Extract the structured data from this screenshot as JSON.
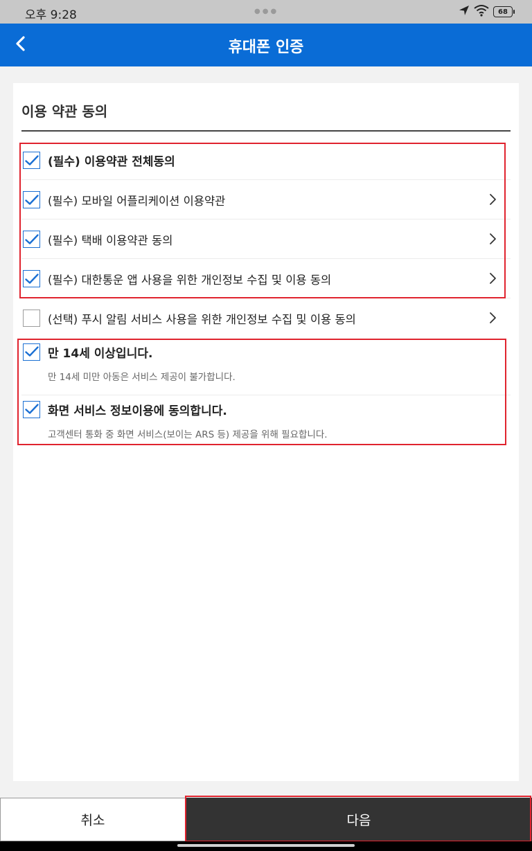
{
  "status_bar": {
    "time": "오후 9:28",
    "battery": "68",
    "icons": [
      "location-arrow-icon",
      "wifi-icon",
      "battery-icon"
    ]
  },
  "header": {
    "title": "휴대폰 인증",
    "back_icon": "chevron-left-icon",
    "background": "#0a6cd6"
  },
  "card": {
    "title": "이용 약관 동의"
  },
  "terms": {
    "all": {
      "label": "(필수) 이용약관 전체동의",
      "checked": true
    },
    "items": [
      {
        "label": "(필수) 모바일 어플리케이션 이용약관",
        "checked": true
      },
      {
        "label": "(필수) 택배 이용약관 동의",
        "checked": true
      },
      {
        "label": "(필수) 대한통운 앱 사용을 위한 개인정보 수집 및 이용 동의",
        "checked": true
      },
      {
        "label": "(선택) 푸시 알림 서비스 사용을 위한 개인정보 수집 및 이용 동의",
        "checked": false
      }
    ]
  },
  "confirmations": [
    {
      "label": "만 14세 이상입니다.",
      "sub": "만 14세 미만 아동은 서비스 제공이 불가합니다.",
      "checked": true
    },
    {
      "label": "화면 서비스 정보이용에 동의합니다.",
      "sub": "고객센터 통화 중 화면 서비스(보이는 ARS 등) 제공을 위해 필요합니다.",
      "checked": true
    }
  ],
  "footer": {
    "cancel_label": "취소",
    "next_label": "다음"
  },
  "colors": {
    "accent": "#0a6cd6",
    "check": "#1a6fd3",
    "highlight": "#e0232e",
    "next_button": "#333333"
  }
}
